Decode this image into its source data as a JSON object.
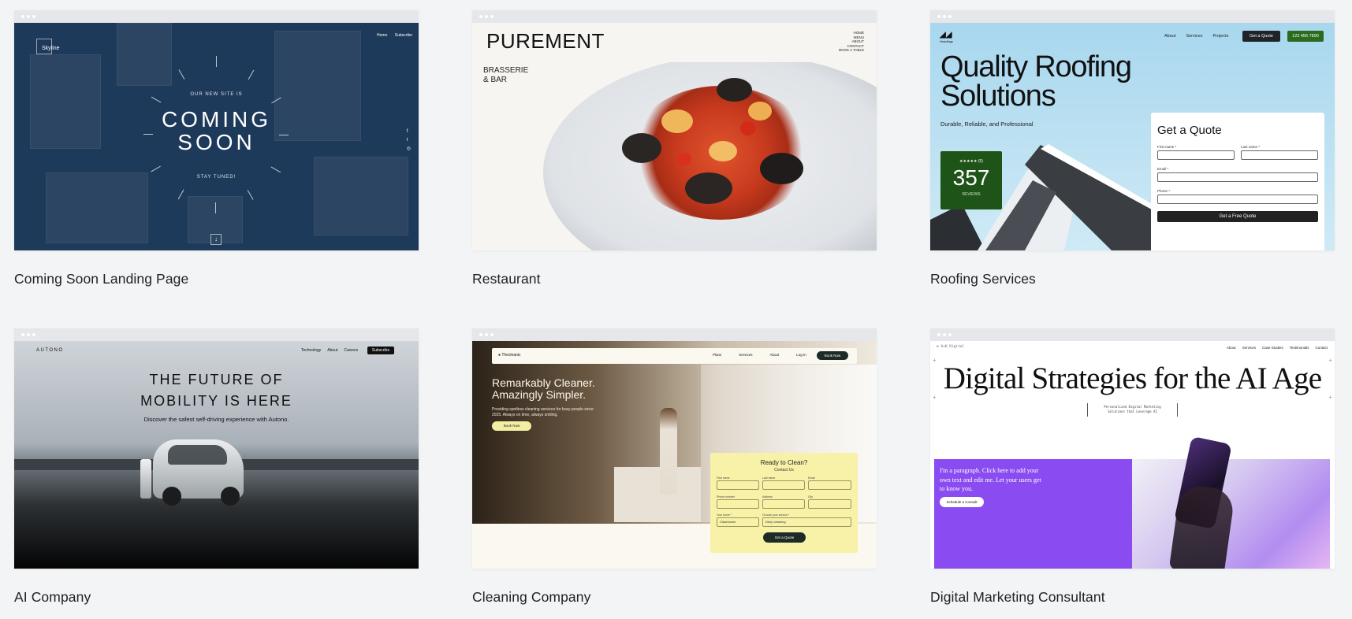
{
  "cards": [
    {
      "caption": "Coming Soon Landing Page",
      "logo": "Skyline",
      "nav": [
        "Home",
        "Subscribe"
      ],
      "pre_title": "OUR NEW SITE IS",
      "title_line1": "COMING",
      "title_line2": "SOON",
      "post_title": "STAY TUNED!",
      "social": [
        "f",
        "t",
        "◎"
      ]
    },
    {
      "caption": "Restaurant",
      "logo": "PUREMENT",
      "nav": [
        "HOME",
        "MENU",
        "ABOUT",
        "CONTACT",
        "BOOK A TABLE"
      ],
      "sub_line1": "BRASSERIE",
      "sub_line2": "& BAR"
    },
    {
      "caption": "Roofing Services",
      "logo": "Headings",
      "nav": [
        "About",
        "Services",
        "Projects"
      ],
      "quote_button": "Get a Quote",
      "phone_button": "123 456 7890",
      "title_line1": "Quality Roofing",
      "title_line2": "Solutions",
      "tagline": "Durable, Reliable, and Professional",
      "badge_stars": "★★★★★ (5)",
      "badge_number": "357",
      "badge_label": "REVIEWS",
      "form_title": "Get a Quote",
      "form_fields": [
        "First name *",
        "Last name *",
        "Email *",
        "Phone *"
      ],
      "form_button": "Get a Free Quote"
    },
    {
      "caption": "AI Company",
      "logo": "AUTONO",
      "nav": [
        "Technology",
        "About",
        "Careers"
      ],
      "subscribe": "Subscribe",
      "title_line1": "THE FUTURE OF",
      "title_line2": "MOBILITY IS HERE",
      "description": "Discover the safest self-driving experience with Autono."
    },
    {
      "caption": "Cleaning Company",
      "logo": "● Thecleanic",
      "nav": [
        "Plans",
        "Services",
        "About",
        "Log In"
      ],
      "book_button": "Book Now",
      "title_line1": "Remarkably Cleaner.",
      "title_line2": "Amazingly Simpler.",
      "description": "Providing spotless cleaning services for busy people since 2025. Always on time, always smiling.",
      "hero_button": "Book Now",
      "form_title": "Ready to Clean?",
      "form_subtitle": "Contact Us",
      "form_labels": [
        "First name",
        "Last name",
        "Email",
        "Phone number",
        "Address",
        "City",
        "Your home *",
        "Choose your service *"
      ],
      "select1": "Cleanhome",
      "select2": "Deep cleaning",
      "form_button": "Get a Quote"
    },
    {
      "caption": "Digital Marketing Consultant",
      "logo": "⊕ A+K Digital",
      "nav": [
        "About",
        "Services",
        "Case Studies",
        "Testimonials",
        "Contact"
      ],
      "title": "Digital Strategies for the AI Age",
      "tag_line1": "Personalized Digital Marketing",
      "tag_line2": "Solutions that Leverage AI",
      "paragraph": "I'm a paragraph. Click here to add your own text and edit me. Let your users get to know you.",
      "cta": "Schedule a Consult"
    }
  ]
}
